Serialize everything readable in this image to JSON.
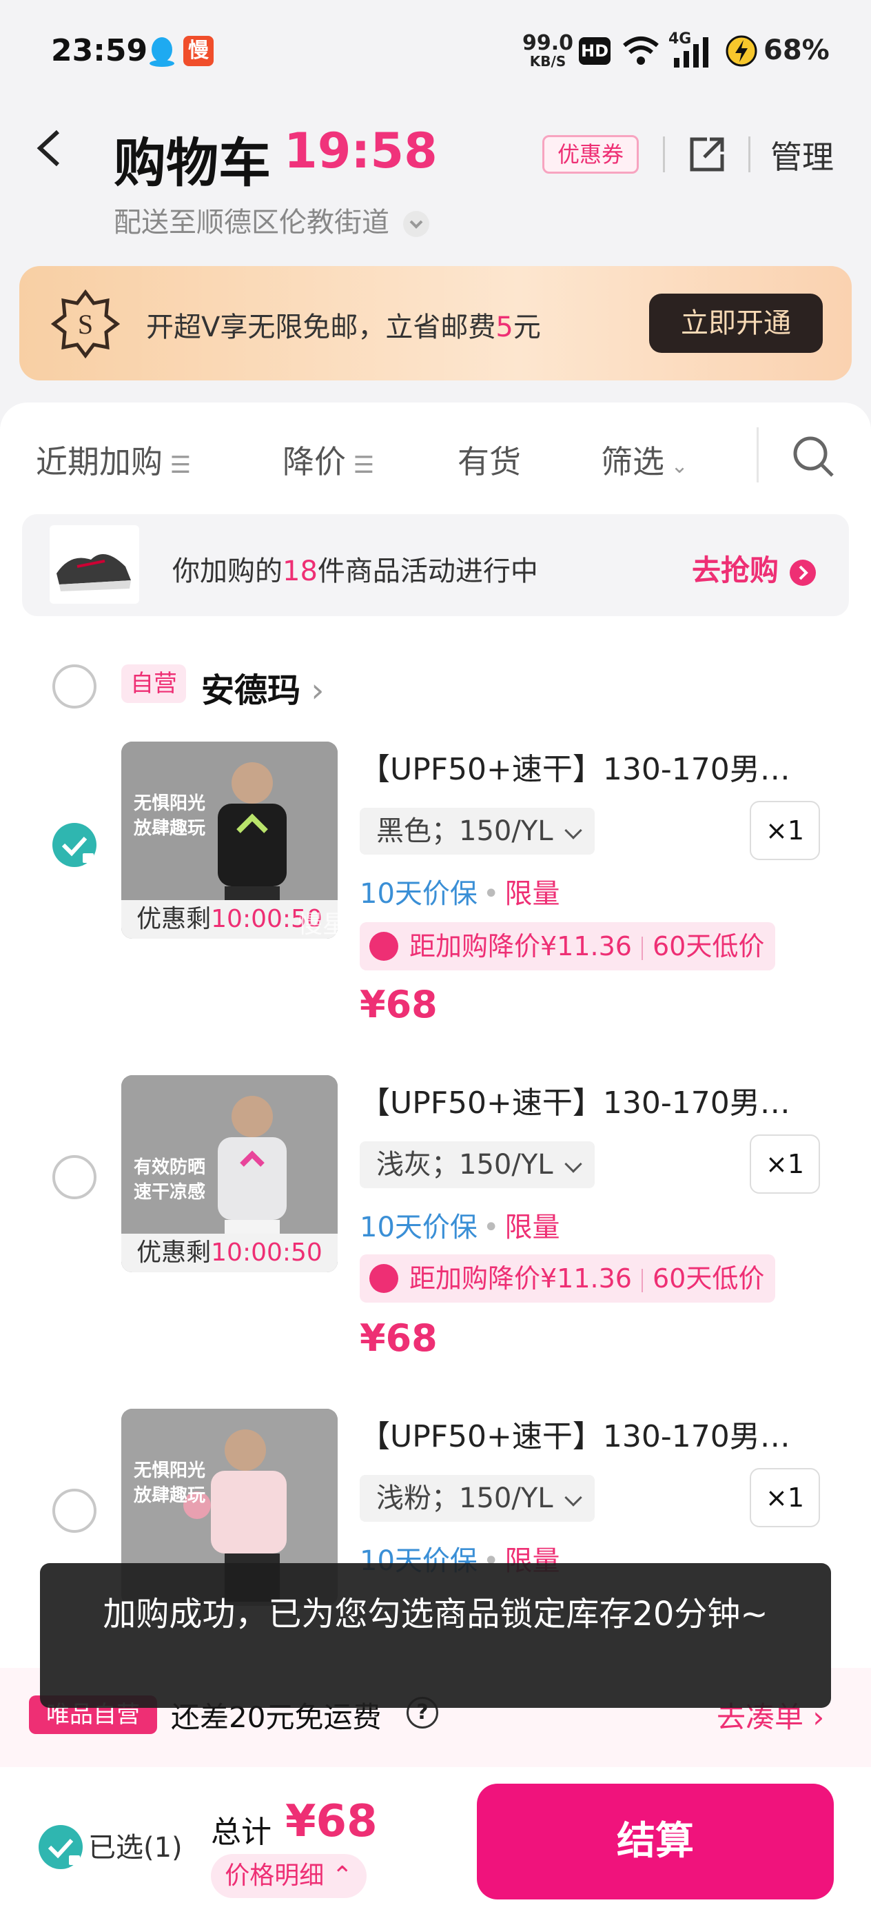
{
  "status_bar": {
    "time": "23:59",
    "net_speed": "99.0",
    "net_unit": "KB/S",
    "hd": "HD",
    "network": "4G",
    "battery": "68%"
  },
  "header": {
    "title": "购物车",
    "timer": "19:58",
    "coupon": "优惠券",
    "manage": "管理",
    "address": "配送至顺德区伦教街道"
  },
  "banner": {
    "text_prefix": "开超V享无限免邮，立省邮费",
    "text_amount": "5",
    "text_suffix": "元",
    "button": "立即开通"
  },
  "filters": [
    {
      "label": "近期加购"
    },
    {
      "label": "降价"
    },
    {
      "label": "有货"
    },
    {
      "label": "筛选"
    }
  ],
  "promo": {
    "prefix": "你加购的",
    "count": "18",
    "suffix": "件商品活动进行中",
    "action": "去抢购"
  },
  "store": {
    "tag": "自营",
    "name": "安德玛"
  },
  "items": [
    {
      "title": "【UPF50+速干】130-170男…",
      "spec": "黑色；150/YL",
      "qty": "×1",
      "badge": "无惧阳光\n放肆趣玩",
      "countdown_label": "优惠剩",
      "countdown": "10:00:50",
      "guarantee": "10天价保",
      "limit": "限量",
      "drop": "距加购降价¥11.36",
      "low": "60天低价",
      "price": "¥68",
      "checked": true
    },
    {
      "title": "【UPF50+速干】130-170男…",
      "spec": "浅灰；150/YL",
      "qty": "×1",
      "badge": "有效防晒\n速干凉感",
      "countdown_label": "优惠剩",
      "countdown": "10:00:50",
      "guarantee": "10天价保",
      "limit": "限量",
      "drop": "距加购降价¥11.36",
      "low": "60天低价",
      "price": "¥68",
      "checked": false
    },
    {
      "title": "【UPF50+速干】130-170男…",
      "spec": "浅粉；150/YL",
      "qty": "×1",
      "badge": "无惧阳光\n放肆趣玩",
      "guarantee": "10天价保",
      "limit": "限量",
      "checked": false
    }
  ],
  "watermark": "慢星人690211(6KL",
  "toast": "加购成功，已为您勾选商品锁定库存20分钟~",
  "shipping": {
    "tag": "唯品自营",
    "text": "还差20元免运费",
    "action": "去凑单"
  },
  "bottom": {
    "selected": "已选(1)",
    "total_label": "总计",
    "total": "¥68",
    "detail": "价格明细",
    "checkout": "结算"
  },
  "colors": {
    "accent": "#ee2f74",
    "checkout": "#f0137c",
    "check": "#2fb6b0"
  }
}
